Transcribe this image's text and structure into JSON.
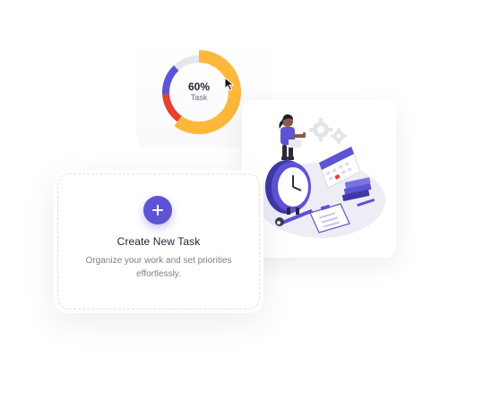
{
  "progress_widget": {
    "percent_label": "60%",
    "sublabel": "Task",
    "percent_value": 60,
    "segments": [
      {
        "name": "complete",
        "fraction": 0.6,
        "color": "#FDB73A"
      },
      {
        "name": "red",
        "fraction": 0.14,
        "color": "#E8412F"
      },
      {
        "name": "purple",
        "fraction": 0.14,
        "color": "#5D53D4"
      },
      {
        "name": "remaining",
        "fraction": 0.12,
        "color": "#E6E6EC"
      }
    ]
  },
  "create_task": {
    "add_icon": "plus-icon",
    "title": "Create New Task",
    "description": "Organize your work and set priorities effortlessly."
  },
  "illustration": {
    "icon": "task-planning-illustration"
  },
  "colors": {
    "accent": "#5D53D4",
    "yellow": "#FDB73A",
    "red": "#E8412F",
    "track": "#E6E6EC"
  }
}
